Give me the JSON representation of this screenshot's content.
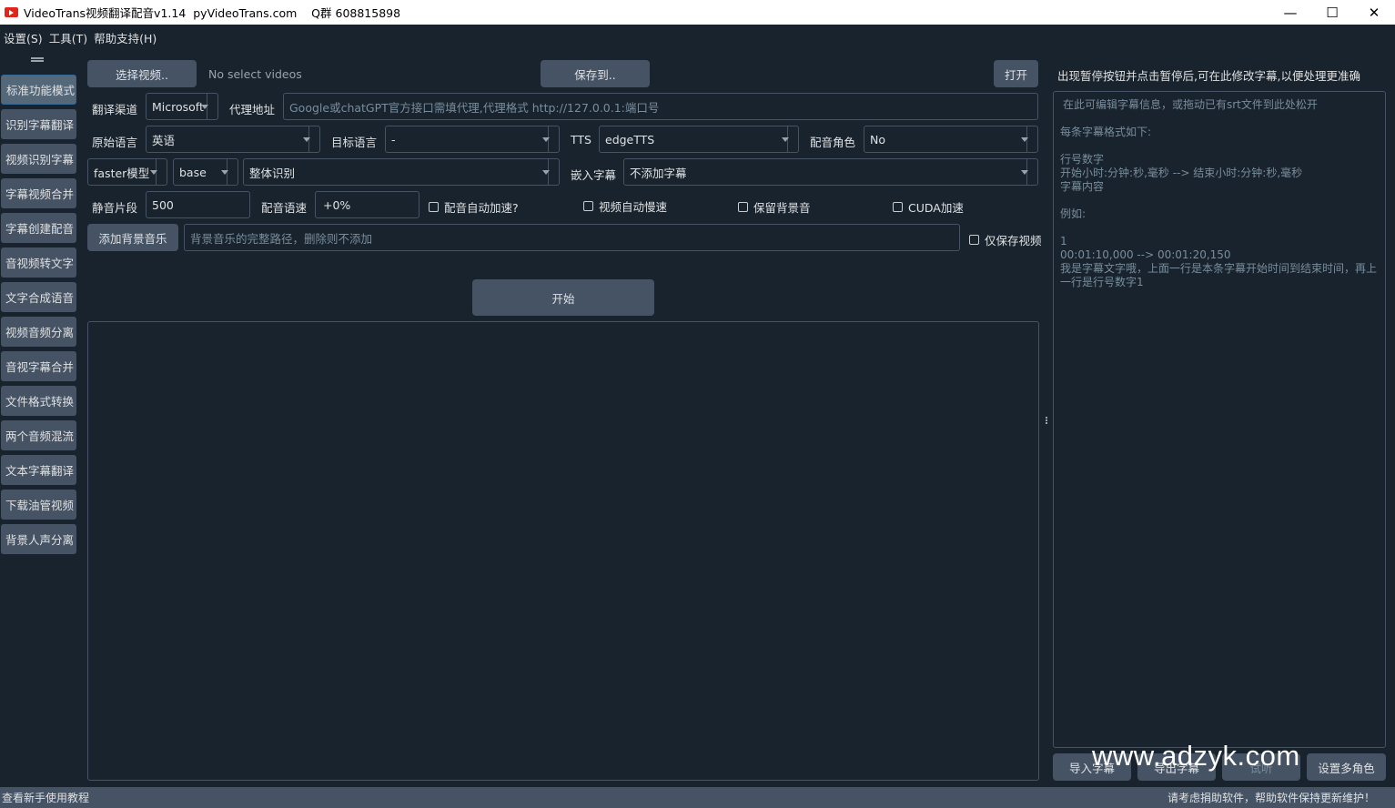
{
  "window": {
    "title": "VideoTrans视频翻译配音v1.14  pyVideoTrans.com    Q群 608815898",
    "minimize_glyph": "—",
    "maximize_glyph": "☐",
    "close_glyph": "✕"
  },
  "menu": [
    "设置(S)",
    "工具(T)",
    "帮助支持(H)"
  ],
  "sidebar": {
    "items": [
      {
        "label": "标准功能模式",
        "active": true
      },
      {
        "label": "识别字幕翻译"
      },
      {
        "label": "视频识别字幕"
      },
      {
        "label": "字幕视频合并"
      },
      {
        "label": "字幕创建配音"
      },
      {
        "label": "音视频转文字"
      },
      {
        "label": "文字合成语音"
      },
      {
        "label": "视频音频分离"
      },
      {
        "label": "音视字幕合并"
      },
      {
        "label": "文件格式转换"
      },
      {
        "label": "两个音频混流"
      },
      {
        "label": "文本字幕翻译"
      },
      {
        "label": "下载油管视频"
      },
      {
        "label": "背景人声分离"
      }
    ]
  },
  "main": {
    "select_video_button": "选择视频..",
    "selected_video_text": "No select videos",
    "save_to_button": "保存到..",
    "open_button": "打开",
    "translate_channel_label": "翻译渠道",
    "translate_channel_value": "Microsoft",
    "proxy_label": "代理地址",
    "proxy_placeholder": "Google或chatGPT官方接口需填代理,代理格式 http://127.0.0.1:端口号",
    "source_lang_label": "原始语言",
    "source_lang_value": "英语",
    "target_lang_label": "目标语言",
    "target_lang_value": "-",
    "tts_label": "TTS",
    "tts_value": "edgeTTS",
    "voice_role_label": "配音角色",
    "voice_role_value": "No",
    "model_type_value": "faster模型",
    "model_size_value": "base",
    "recognition_mode_value": "整体识别",
    "embed_subtitle_label": "嵌入字幕",
    "embed_subtitle_value": "不添加字幕",
    "silence_label": "静音片段",
    "silence_value": "500",
    "voice_rate_label": "配音语速",
    "voice_rate_value": "+0%",
    "auto_speedup_label": "配音自动加速?",
    "auto_slowdown_label": "视频自动慢速",
    "keep_bgm_label": "保留背景音",
    "cuda_label": "CUDA加速",
    "add_bgm_button": "添加背景音乐",
    "bgm_placeholder": "背景音乐的完整路径，删除则不添加",
    "only_video_label": "仅保存视频",
    "start_button": "开始"
  },
  "right_panel": {
    "title": "出现暂停按钮并点击暂停后,可在此修改字幕,以便处理更准确",
    "placeholder_lines": [
      "在此可编辑字幕信息，或拖动已有srt文件到此处松开",
      "",
      "每条字幕格式如下:",
      "",
      "行号数字",
      "开始小时:分钟:秒,毫秒 --> 结束小时:分钟:秒,毫秒",
      "字幕内容",
      "",
      "例如:",
      "",
      "1",
      "00:01:10,000 --> 00:01:20,150",
      "我是字幕文字哦，上面一行是本条字幕开始时间到结束时间，再上一行是行号数字1"
    ],
    "import_button": "导入字幕",
    "export_button": "导出字幕",
    "listen_button": "试听",
    "multi_role_button": "设置多角色"
  },
  "statusbar": {
    "left": "查看新手使用教程",
    "right": "请考虑捐助软件，帮助软件保持更新维护！"
  },
  "watermark": "www.adzyk.com",
  "colors": {
    "background": "#19232d",
    "button": "#455364",
    "border": "#455364",
    "text": "#dfe1e2",
    "placeholder": "#788d9c",
    "accent": "#346792",
    "app_icon": "#e0251b"
  }
}
